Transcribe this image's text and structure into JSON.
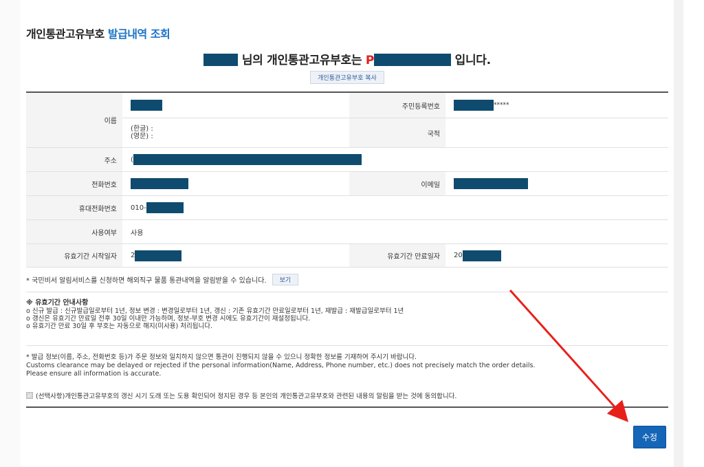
{
  "title": {
    "prefix": "개인통관고유부호",
    "accent": "발급내역 조회"
  },
  "headline": {
    "suffix_name": "님의 개인통관고유부호는",
    "code_prefix": "P",
    "suffix_end": "입니다."
  },
  "copy_button_label": "개인통관고유부호 복사",
  "table": {
    "name_label": "이름",
    "name_kor": "(한글) :",
    "name_eng": "(영문) :",
    "rrn_label": "주민등록번호",
    "rrn_mask": "*****",
    "nationality_label": "국적",
    "address_label": "주소",
    "address_prefix": "(",
    "phone_label": "전화번호",
    "email_label": "이메일",
    "mobile_label": "휴대전화번호",
    "mobile_prefix": "010-",
    "usage_label": "사용여부",
    "usage_value": "사용",
    "start_label": "유효기간 시작일자",
    "start_prefix": "2",
    "end_label": "유효기간 만료일자",
    "end_prefix": "20"
  },
  "notice": {
    "text": "* 국민비서 알림서비스를 신청하면 해외직구 물품 통관내역을 알림받을 수 있습니다.",
    "view_label": "보기"
  },
  "guide": {
    "title": "※ 유효기간 안내사항",
    "lines": [
      "o 신규 발급 : 신규발급일로부터 1년, 정보 변경 : 변경일로부터 1년, 갱신 : 기존 유효기간 만료일로부터 1년, 재발급 : 재발급일로부터 1년",
      "o 갱신은 유효기간 만료일 전후 30일 이내만 가능하며, 정보-부호 변경 시에도 유효기간이 재설정됩니다.",
      "o 유효기간 만료 30일 후 부호는 자동으로 해지(미사용) 처리됩니다."
    ]
  },
  "warning": {
    "korean": "* 발급 정보(이름, 주소, 전화번호 등)가 주문 정보와 일치하지 않으면 통관이 진행되지 않을 수 있으니 정확한 정보를 기재하여 주시기 바랍니다.",
    "english1": "Customs clearance may be delayed or rejected if the personal information(Name, Address, Phone number, etc.) does not precisely match the order details.",
    "english2": "Please ensure all information is accurate."
  },
  "consent_text": "(선택사항)개인통관고유부호의 갱신 시기 도래 또는 도용 확인되어 정지된 경우 등 본인의 개인통관고유부호와 관련된 내용의 알림을 받는 것에 동의합니다.",
  "edit_button_label": "수정",
  "colors": {
    "accent": "#1a73c8",
    "redaction": "#0f4b6e",
    "code_red": "#e02020",
    "button_blue": "#1565b8",
    "arrow_red": "#e8201a"
  }
}
